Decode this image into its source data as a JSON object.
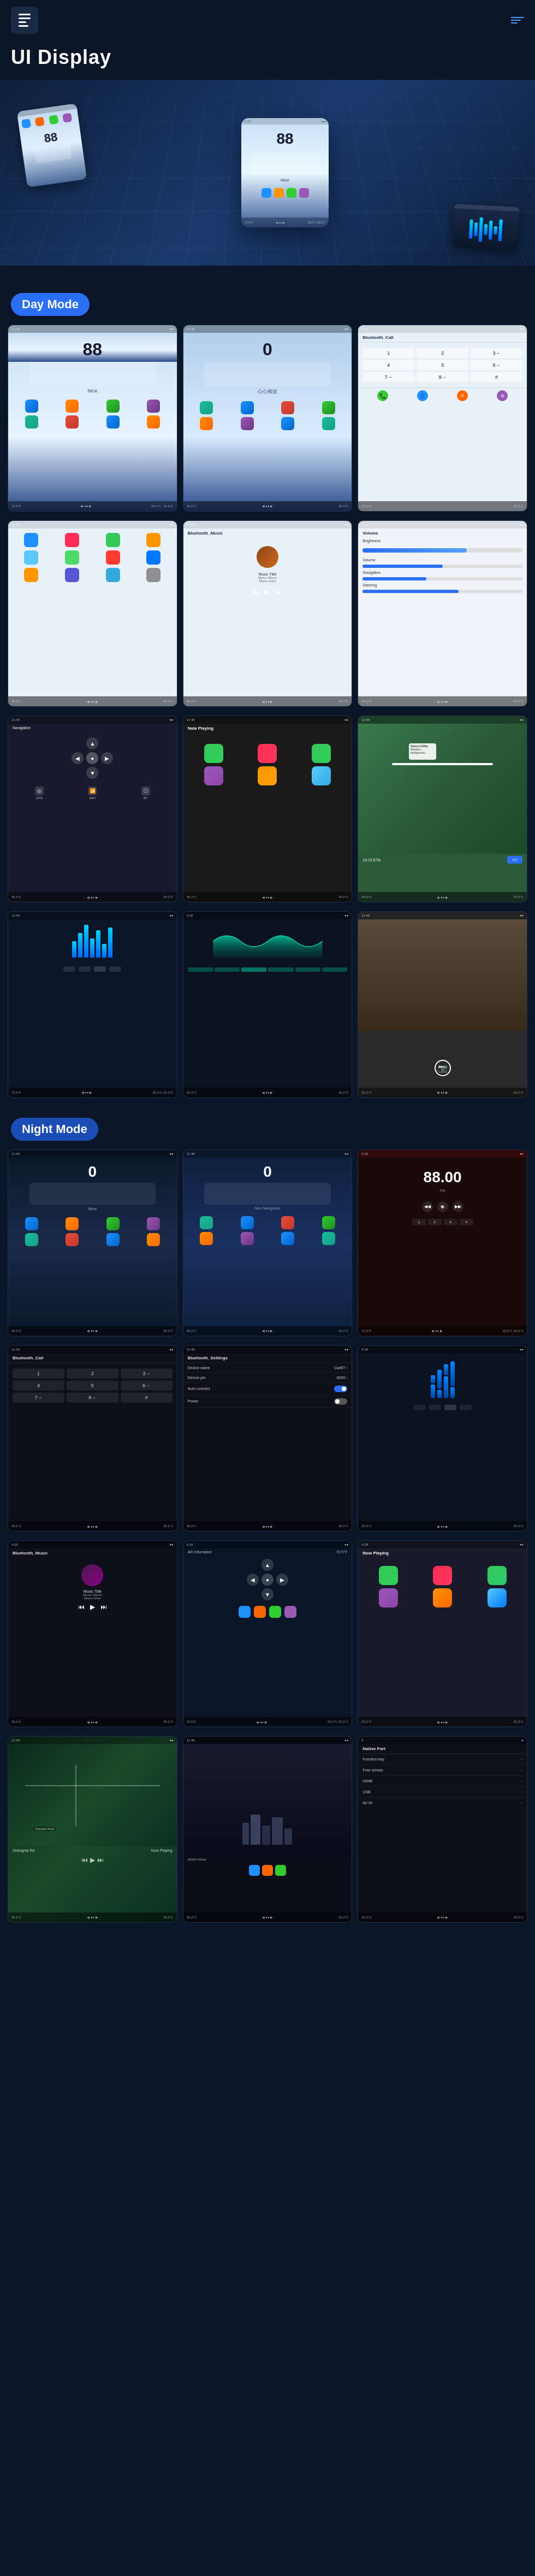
{
  "header": {
    "logo_icon": "grid-icon",
    "menu_icon": "menu-lines-icon",
    "title": "UI Display"
  },
  "hero": {
    "speed": "88",
    "nice_label": "Nice"
  },
  "day_mode": {
    "label": "Day Mode",
    "screens": [
      {
        "id": "day-home-88",
        "speed": "88",
        "sublabel": "Nice",
        "type": "home"
      },
      {
        "id": "day-home-0",
        "speed": "0",
        "sublabel": "心心相连",
        "type": "home2"
      },
      {
        "id": "day-dial",
        "title": "Bluetooth_Call",
        "type": "dial"
      },
      {
        "id": "day-apps",
        "type": "apps"
      },
      {
        "id": "day-music",
        "title": "Bluetooth_Music",
        "artist": "Music Title\nMusic Album\nMusic Artist",
        "type": "music"
      },
      {
        "id": "day-settings-vol",
        "title": "Volume",
        "type": "volume-settings"
      },
      {
        "id": "day-nav",
        "type": "navigation"
      },
      {
        "id": "day-carplay",
        "type": "carplay"
      },
      {
        "id": "day-maps",
        "type": "maps"
      },
      {
        "id": "day-eq1",
        "type": "eq"
      },
      {
        "id": "day-eq2",
        "type": "eq-wave"
      },
      {
        "id": "day-camera",
        "type": "camera"
      }
    ]
  },
  "night_mode": {
    "label": "Night Mode",
    "screens": [
      {
        "id": "night-home-0",
        "speed": "0",
        "type": "night-home"
      },
      {
        "id": "night-home-nav",
        "speed": "0",
        "type": "night-home2"
      },
      {
        "id": "night-radio",
        "freq": "88.00",
        "type": "radio"
      },
      {
        "id": "night-dial",
        "title": "Bluetooth_Call",
        "type": "night-dial"
      },
      {
        "id": "night-bt-settings",
        "title": "Bluetooth_Settings",
        "type": "night-bt-settings"
      },
      {
        "id": "night-eq",
        "type": "night-eq"
      },
      {
        "id": "night-music",
        "title": "Bluetooth_Music",
        "type": "night-music"
      },
      {
        "id": "night-nav",
        "type": "night-nav"
      },
      {
        "id": "night-carplay",
        "type": "night-carplay"
      },
      {
        "id": "night-map2",
        "type": "night-map"
      },
      {
        "id": "night-adas",
        "type": "night-adas"
      },
      {
        "id": "night-sidebar",
        "title": "Native Part",
        "type": "night-sidebar"
      }
    ]
  },
  "status": {
    "temp_left": "25.2°C",
    "temp_right": "25.2°C",
    "time_display": "72.5°F"
  },
  "colors": {
    "bg_dark": "#0a1628",
    "bg_medium": "#1a2a4a",
    "accent_blue": "#2a6ff5",
    "accent_teal": "#00d4aa",
    "night_red": "#cc0000",
    "day_bg": "#c8dff5"
  }
}
